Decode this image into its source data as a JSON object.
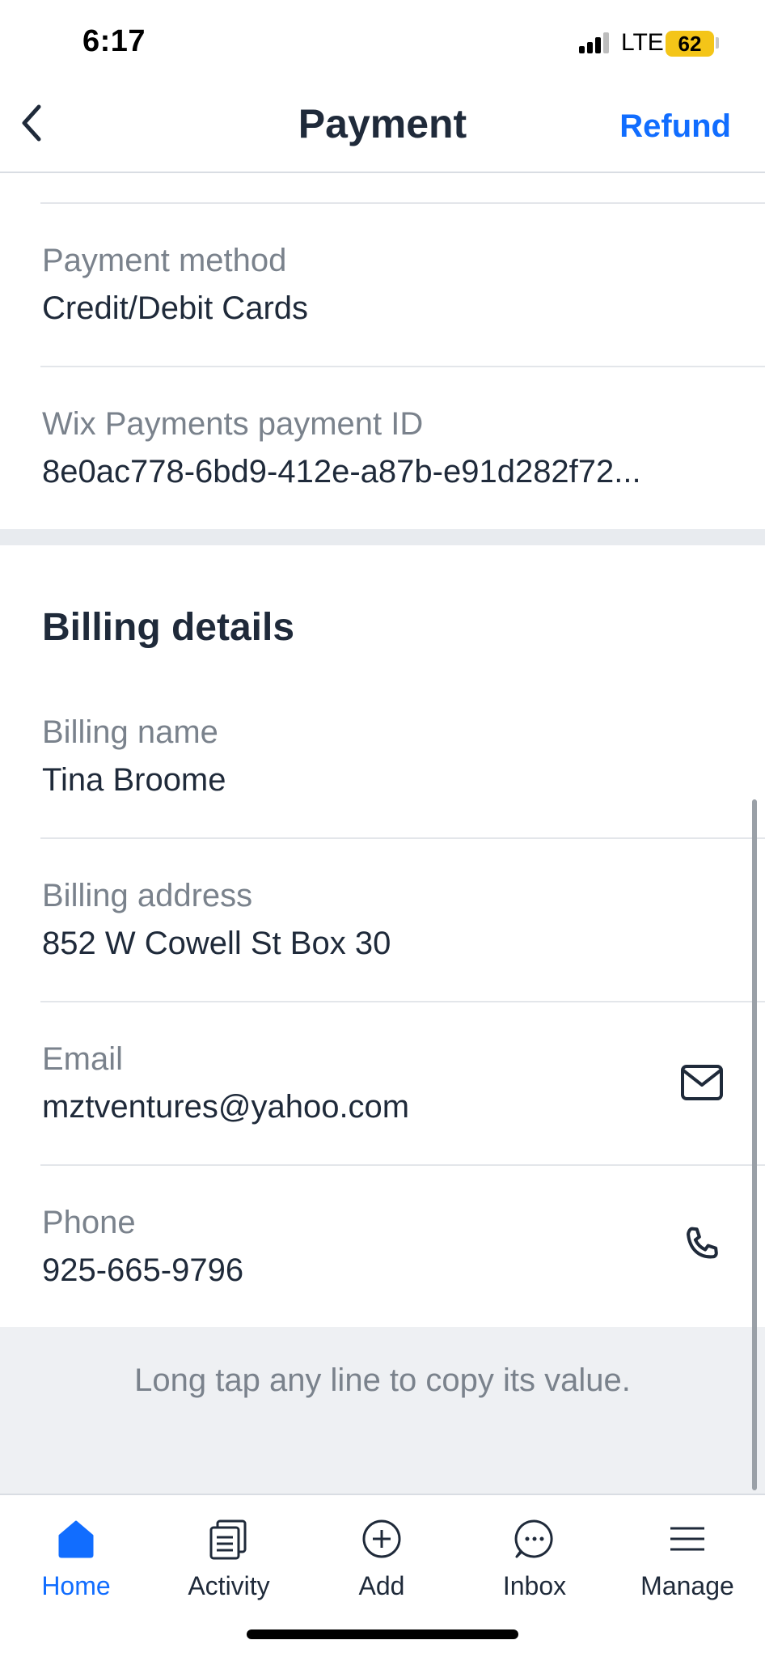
{
  "status": {
    "time": "6:17",
    "network": "LTE",
    "battery": "62"
  },
  "header": {
    "title": "Payment",
    "refund_label": "Refund"
  },
  "payment_rows": [
    {
      "label": "Payment method",
      "value": "Credit/Debit Cards"
    },
    {
      "label": "Wix Payments payment ID",
      "value": "8e0ac778-6bd9-412e-a87b-e91d282f72..."
    }
  ],
  "billing": {
    "title": "Billing details",
    "name": {
      "label": "Billing name",
      "value": "Tina Broome"
    },
    "address": {
      "label": "Billing address",
      "value": "852 W Cowell St Box 30"
    },
    "email": {
      "label": "Email",
      "value": "mztventures@yahoo.com"
    },
    "phone": {
      "label": "Phone",
      "value": "925-665-9796"
    }
  },
  "hint": "Long tap any line to copy its value.",
  "tabs": [
    {
      "label": "Home",
      "icon": "home-icon",
      "active": true
    },
    {
      "label": "Activity",
      "icon": "activity-icon",
      "active": false
    },
    {
      "label": "Add",
      "icon": "add-icon",
      "active": false
    },
    {
      "label": "Inbox",
      "icon": "inbox-icon",
      "active": false
    },
    {
      "label": "Manage",
      "icon": "manage-icon",
      "active": false
    }
  ],
  "colors": {
    "accent": "#116dff",
    "text": "#1f2a3a",
    "muted": "#7a828c",
    "battery": "#f4c518"
  }
}
